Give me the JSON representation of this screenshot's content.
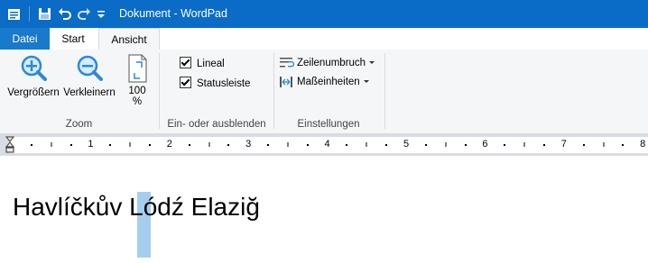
{
  "window": {
    "title": "Dokument - WordPad"
  },
  "tabs": {
    "file": "Datei",
    "start": "Start",
    "view": "Ansicht"
  },
  "ribbon": {
    "zoom": {
      "label": "Zoom",
      "zoom_in": "Vergrößern",
      "zoom_out": "Verkleinern",
      "hundred_line1": "100",
      "hundred_line2": "%"
    },
    "show_hide": {
      "label": "Ein- oder ausblenden",
      "ruler": "Lineal",
      "ruler_checked": true,
      "statusbar": "Statusleiste",
      "statusbar_checked": true
    },
    "settings": {
      "label": "Einstellungen",
      "word_wrap": "Zeilenumbruch",
      "units": "Maßeinheiten"
    }
  },
  "ruler": {
    "numbers": [
      "1",
      "2",
      "3",
      "4",
      "5",
      "6",
      "7",
      "8"
    ]
  },
  "document": {
    "text": "Havlíčkův Lódź Elaziğ"
  }
}
